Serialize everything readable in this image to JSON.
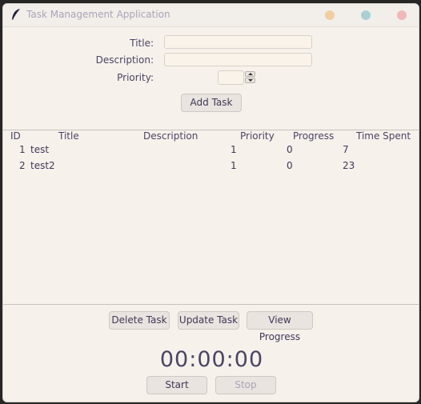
{
  "window": {
    "title": "Task Management Application"
  },
  "form": {
    "title_label": "Title:",
    "description_label": "Description:",
    "priority_label": "Priority:",
    "title_value": "",
    "description_value": "",
    "priority_value": "",
    "add_button": "Add Task"
  },
  "table": {
    "headers": [
      "ID",
      "Title",
      "Description",
      "Priority",
      "Progress",
      "Time Spent"
    ],
    "rows": [
      {
        "id": "1",
        "title": "test",
        "description": "",
        "priority": "1",
        "progress": "0",
        "time": "7"
      },
      {
        "id": "2",
        "title": "test2",
        "description": "",
        "priority": "1",
        "progress": "0",
        "time": "23"
      }
    ]
  },
  "actions": {
    "delete": "Delete Task",
    "update": "Update Task",
    "view": "View Progress"
  },
  "timer": {
    "display": "00:00:00",
    "start": "Start",
    "stop": "Stop"
  },
  "colors": {
    "background": "#f7f1ec",
    "text": "#4a4463",
    "minimize": "#f1cfa3",
    "maximize": "#a8cfd4",
    "close": "#efb9b9"
  },
  "icons": {
    "app": "feather-icon",
    "spin_up": "chevron-up-icon",
    "spin_down": "chevron-down-icon"
  }
}
